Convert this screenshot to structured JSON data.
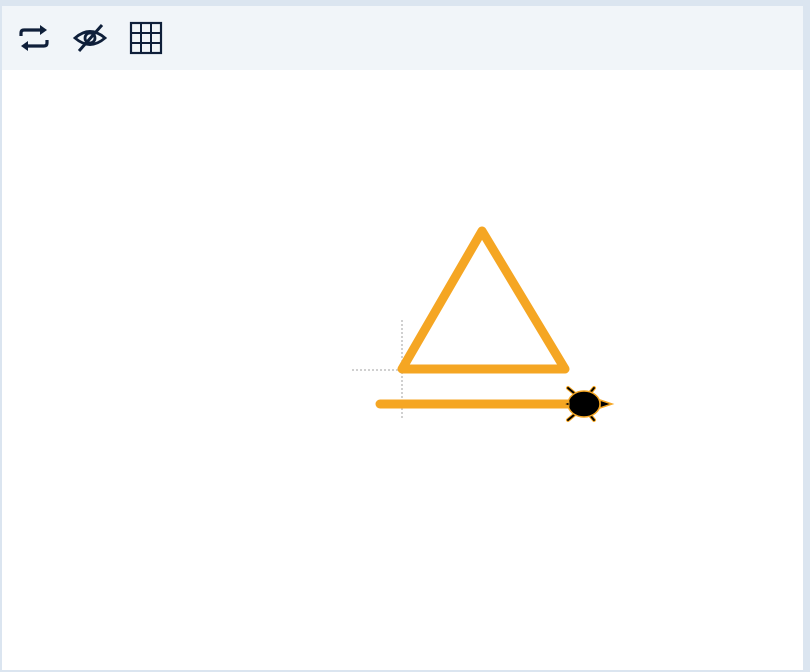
{
  "toolbar": {
    "buttons": [
      {
        "id": "repeat",
        "icon": "repeat-icon"
      },
      {
        "id": "hide",
        "icon": "eye-off-icon"
      },
      {
        "id": "grid",
        "icon": "grid-icon"
      }
    ]
  },
  "colors": {
    "app_background": "#dbe5f0",
    "toolbar_background": "#f1f5f9",
    "canvas_background": "#ffffff",
    "icon": "#0f1f3a",
    "pen": "#f5a623",
    "turtle_body": "#000000",
    "turtle_outline": "#f5a623",
    "axes": "#a0a0a0"
  },
  "canvas": {
    "pen_width": 9,
    "triangle_side": 165,
    "bottom_line_length": 185,
    "turtle_heading": "east"
  }
}
